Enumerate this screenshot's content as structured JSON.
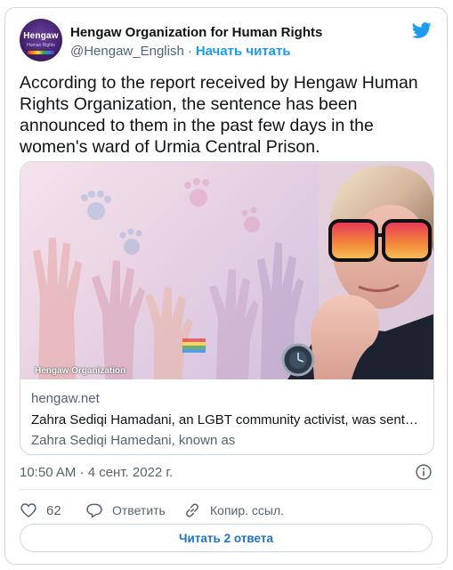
{
  "account": {
    "name": "Hengaw Organization for Human Rights",
    "handle": "@Hengaw_English",
    "separator": "·",
    "follow": "Начать читать",
    "avatar_text": "Hengaw",
    "avatar_subtext": "Human Rights"
  },
  "tweet": {
    "text": "According to the report received by Hengaw Human Rights Organization, the sentence has been announced to them in the past few days in the women's ward of Urmia Central Prison."
  },
  "link_card": {
    "watermark": "Hengaw Organization",
    "domain": "hengaw.net",
    "title": "Zahra Sediqi Hamadani, an LGBT community activist, was sentenced to death...",
    "description": "Zahra Sediqi Hamedani, known as"
  },
  "meta": {
    "timestamp": "10:50 AM · 4 сент. 2022 г."
  },
  "actions": {
    "likes": "62",
    "reply": "Ответить",
    "copy_link": "Копир. ссыл."
  },
  "replies_button": "Читать 2 ответа",
  "colors": {
    "accent": "#1d9bf0",
    "text": "#0f1419",
    "muted": "#536471",
    "border": "#cfd9de"
  }
}
